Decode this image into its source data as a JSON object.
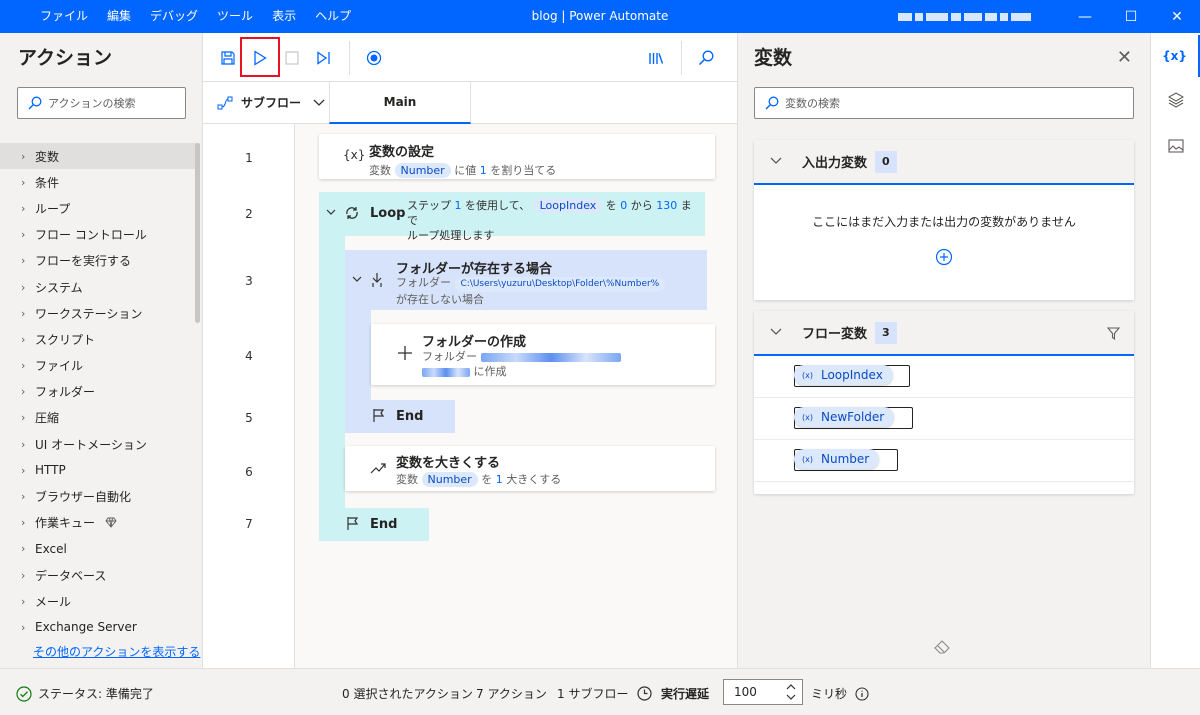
{
  "window": {
    "title": "blog | Power Automate",
    "menu": [
      "ファイル",
      "編集",
      "デバッグ",
      "ツール",
      "表示",
      "ヘルプ"
    ]
  },
  "actions_panel": {
    "title": "アクション",
    "search_placeholder": "アクションの検索",
    "categories": [
      "変数",
      "条件",
      "ループ",
      "フロー コントロール",
      "フローを実行する",
      "システム",
      "ワークステーション",
      "スクリプト",
      "ファイル",
      "フォルダー",
      "圧縮",
      "UI オートメーション",
      "HTTP",
      "ブラウザー自動化",
      "作業キュー",
      "Excel",
      "データベース",
      "メール",
      "Exchange Server"
    ],
    "more_link": "その他のアクションを表示する"
  },
  "designer": {
    "subflow_label": "サブフロー",
    "main_tab": "Main",
    "line_numbers": [
      "1",
      "2",
      "3",
      "4",
      "5",
      "6",
      "7"
    ],
    "steps": {
      "set_var": {
        "title": "変数の設定",
        "icon": "{x}",
        "desc_pre": "変数",
        "var": "Number",
        "desc_mid": "に値",
        "value": "1",
        "desc_post": "を割り当てる"
      },
      "loop": {
        "title": "Loop",
        "d1": "ステップ",
        "step": "1",
        "d2": "を使用して、",
        "var": "LoopIndex",
        "d3": "を",
        "from": "0",
        "d4": "から",
        "to": "130",
        "d5": "まで",
        "d6": "ループ処理します"
      },
      "if_folder": {
        "title": "フォルダーが存在する場合",
        "d1": "フォルダー",
        "path": "C:\\Users\\yuzuru\\Desktop\\Folder\\%Number%",
        "d2": "が存在しない場合"
      },
      "create_folder": {
        "title": "フォルダーの作成",
        "d1": "フォルダー",
        "d2": "に作成"
      },
      "end_if": {
        "title": "End"
      },
      "increase": {
        "title": "変数を大きくする",
        "d1": "変数",
        "var": "Number",
        "d2": "を",
        "value": "1",
        "d3": "大きくする"
      },
      "end_loop": {
        "title": "End"
      }
    }
  },
  "variables_panel": {
    "title": "変数",
    "search_placeholder": "変数の検索",
    "io": {
      "label": "入出力変数",
      "count": "0",
      "empty": "ここにはまだ入力または出力の変数がありません"
    },
    "flow": {
      "label": "フロー変数",
      "count": "3",
      "items": [
        "LoopIndex",
        "NewFolder",
        "Number"
      ]
    },
    "rail_active": "{x}"
  },
  "statusbar": {
    "status": "ステータス: 準備完了",
    "selected": "0 選択されたアクション",
    "actions": "7 アクション",
    "subflows": "1 サブフロー",
    "delay_label": "実行遅延",
    "delay_value": "100",
    "unit": "ミリ秒"
  },
  "colors": {
    "accent": "#0066ff",
    "loop": "#cdf2f4",
    "condition": "#d6e3fa"
  }
}
